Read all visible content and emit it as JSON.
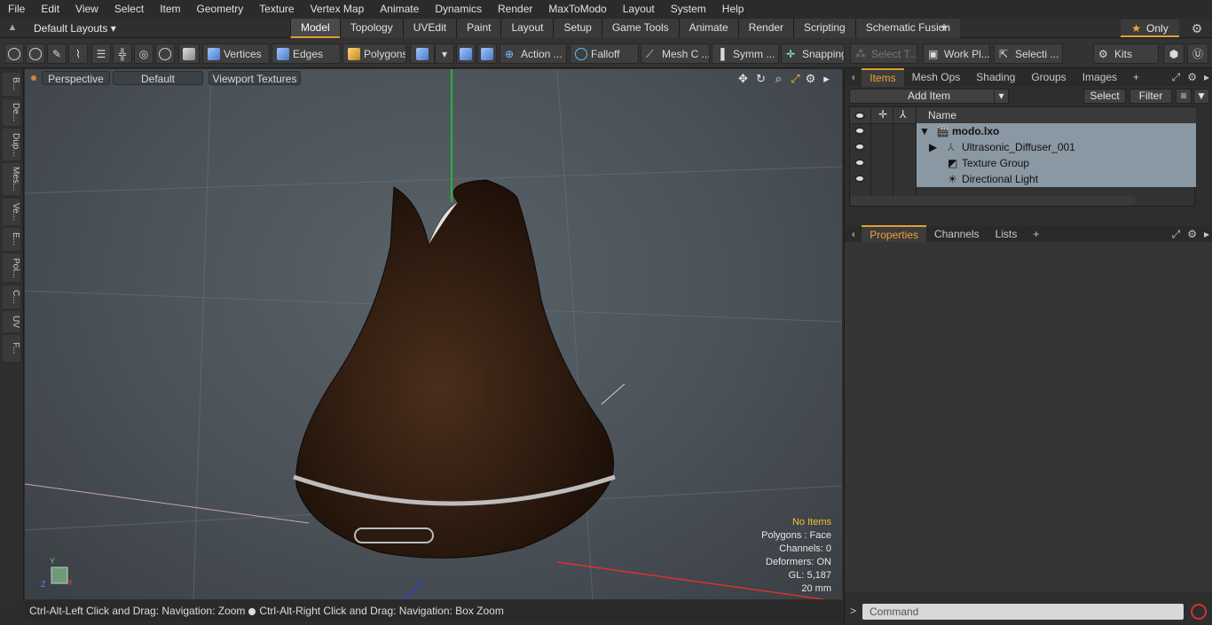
{
  "menu": [
    "File",
    "Edit",
    "View",
    "Select",
    "Item",
    "Geometry",
    "Texture",
    "Vertex Map",
    "Animate",
    "Dynamics",
    "Render",
    "MaxToModo",
    "Layout",
    "System",
    "Help"
  ],
  "layouts": {
    "dropdown": "Default Layouts ▾"
  },
  "tabs": [
    "Model",
    "Topology",
    "UVEdit",
    "Paint",
    "Layout",
    "Setup",
    "Game Tools",
    "Animate",
    "Render",
    "Scripting",
    "Schematic Fusion"
  ],
  "only_label": "Only",
  "toolbar": {
    "vertices": "Vertices",
    "edges": "Edges",
    "polygons": "Polygons",
    "action": "Action ...",
    "falloff": "Falloff",
    "mesh": "Mesh C ...",
    "symm": "Symm ...",
    "snapping": "Snapping",
    "select_t": "Select T...",
    "work_pl": "Work Pl...",
    "selecti": "Selecti ...",
    "kits": "Kits"
  },
  "left_tabs": [
    "B...",
    "De...",
    "Dup...",
    "Mes...",
    "Ve...",
    "E...",
    "Pol...",
    "C...",
    "UV",
    "F..."
  ],
  "viewport": {
    "perspective": "Perspective",
    "default": "Default",
    "textures": "Viewport Textures",
    "info": {
      "no_items": "No Items",
      "polygons": "Polygons : Face",
      "channels": "Channels: 0",
      "deformers": "Deformers: ON",
      "gl": "GL: 5,187",
      "scale": "20 mm"
    }
  },
  "status": {
    "left": "Ctrl-Alt-Left Click and Drag: Navigation: Zoom",
    "right": "Ctrl-Alt-Right Click and Drag: Navigation: Box Zoom"
  },
  "items_panel": {
    "tabs": [
      "Items",
      "Mesh Ops",
      "Shading",
      "Groups",
      "Images"
    ],
    "add_item": "Add Item",
    "select": "Select",
    "filter": "Filter",
    "col_name": "Name",
    "rows": [
      "modo.lxo",
      "Ultrasonic_Diffuser_001",
      "Texture Group",
      "Directional Light"
    ]
  },
  "props_panel": {
    "tabs": [
      "Properties",
      "Channels",
      "Lists"
    ]
  },
  "command": {
    "placeholder": "Command"
  }
}
